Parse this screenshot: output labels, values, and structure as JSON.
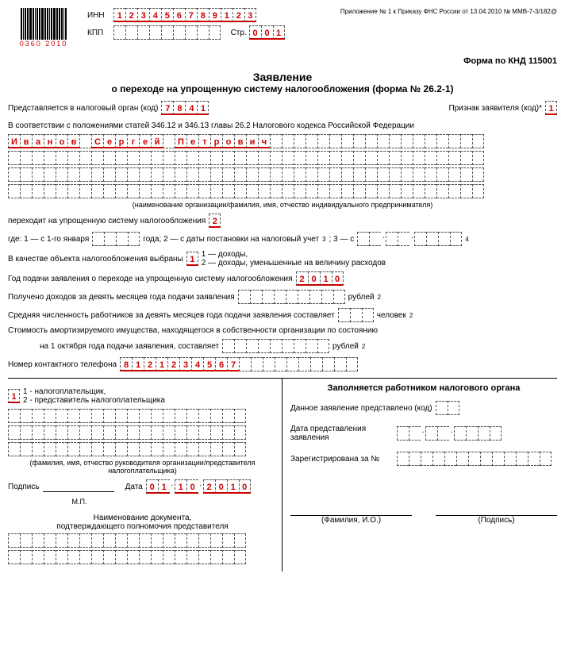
{
  "header": {
    "barcode_text": "0360 2010",
    "inn_label": "ИНН",
    "inn": [
      "1",
      "2",
      "3",
      "4",
      "5",
      "6",
      "7",
      "8",
      "9",
      "1",
      "2",
      "3"
    ],
    "kpp_label": "КПП",
    "kpp": [
      "",
      "",
      "",
      "",
      "",
      "",
      "",
      "",
      ""
    ],
    "page_label": "Стр.",
    "page": [
      "0",
      "0",
      "1"
    ],
    "appendix_note": "Приложение № 1 к Приказу ФНС России от 13.04.2010 № ММВ-7-3/182@",
    "form_code": "Форма по КНД 115001"
  },
  "title": "Заявление",
  "subtitle": "о переходе на упрощенную систему налогообложения (форма № 26.2-1)",
  "tax_office": {
    "label": "Представляется в налоговый орган (код)",
    "code": [
      "7",
      "8",
      "4",
      "1"
    ]
  },
  "applicant_sign": {
    "label": "Признак заявителя (код)*",
    "code": [
      "1"
    ]
  },
  "law_ref": "В соответствии с положениями статей 346.12 и 346.13 главы 26.2 Налогового кодекса Российской Федерации",
  "name_chars": [
    "И",
    "в",
    "а",
    "н",
    "о",
    "в",
    "",
    "С",
    "е",
    "р",
    "г",
    "е",
    "й",
    "",
    "П",
    "е",
    "т",
    "р",
    "о",
    "в",
    "и",
    "ч",
    "",
    "",
    "",
    "",
    "",
    "",
    "",
    "",
    "",
    "",
    "",
    "",
    "",
    "",
    "",
    "",
    "",
    ""
  ],
  "name_caption": "(наименование организации/фамилия, имя, отчество индивидуального предпринимателя)",
  "transition": {
    "label": "переходит на упрощенную систему налогообложения",
    "code": [
      "2"
    ]
  },
  "where_line": {
    "prefix": "где: 1 — с 1-го января",
    "year1": [
      "",
      "",
      "",
      ""
    ],
    "mid1": "года; 2 — с даты постановки на налоговый учет",
    "sup1": "3",
    "mid2": "; 3 — с",
    "date2": [
      "",
      "",
      ".",
      "",
      "",
      ".",
      "",
      "",
      "",
      ""
    ],
    "sup2": "4"
  },
  "object": {
    "label": "В качестве объекта налогообложения выбраны",
    "code": [
      "1"
    ],
    "note1": "1 — доходы,",
    "note2": "2 — доходы, уменьшенные на величину расходов"
  },
  "year_submit": {
    "label": "Год подачи заявления о переходе на упрощенную систему налогообложения",
    "year": [
      "2",
      "0",
      "1",
      "0"
    ]
  },
  "income": {
    "label": "Получено доходов за девять месяцев года подачи заявления",
    "cells": [
      "",
      "",
      "",
      "",
      "",
      "",
      "",
      "",
      ""
    ],
    "unit": "рублей",
    "sup": "2"
  },
  "staff": {
    "label": "Средняя численность работников за девять месяцев года подачи заявления составляет",
    "cells": [
      "",
      "",
      ""
    ],
    "unit": "человек",
    "sup": "2"
  },
  "amort": {
    "label1": "Стоимость амортизируемого имущества, находящегося в собственности организации по состоянию",
    "label2": "на 1 октября года подачи заявления, составляет",
    "cells": [
      "",
      "",
      "",
      "",
      "",
      "",
      "",
      "",
      ""
    ],
    "unit": "рублей",
    "sup": "2"
  },
  "phone": {
    "label": "Номер контактного телефона",
    "cells": [
      "8",
      "1",
      "2",
      "1",
      "2",
      "3",
      "4",
      "5",
      "6",
      "7",
      "",
      "",
      "",
      "",
      "",
      "",
      "",
      "",
      "",
      ""
    ]
  },
  "bottom_left": {
    "legend_code": [
      "1"
    ],
    "legend1": "1 - налогоплательщик,",
    "legend2": "2 - представитель налогоплательщика",
    "name_caption": "(фамилия, имя, отчество руководителя организации/представителя налогоплательщика)",
    "sign_label": "Подпись",
    "date_label": "Дата",
    "date": [
      "0",
      "1",
      ".",
      "1",
      "0",
      ".",
      "2",
      "0",
      "1",
      "0"
    ],
    "mp": "М.П.",
    "doc_title": "Наименование документа,",
    "doc_sub": "подтверждающего полномочия представителя"
  },
  "bottom_right": {
    "title": "Заполняется работником налогового органа",
    "presented": "Данное заявление представлено  (код)",
    "date_present": "Дата представления заявления",
    "reg": "Зарегистрирована за №",
    "fio": "(Фамилия, И.О.)",
    "sign": "(Подпись)"
  }
}
